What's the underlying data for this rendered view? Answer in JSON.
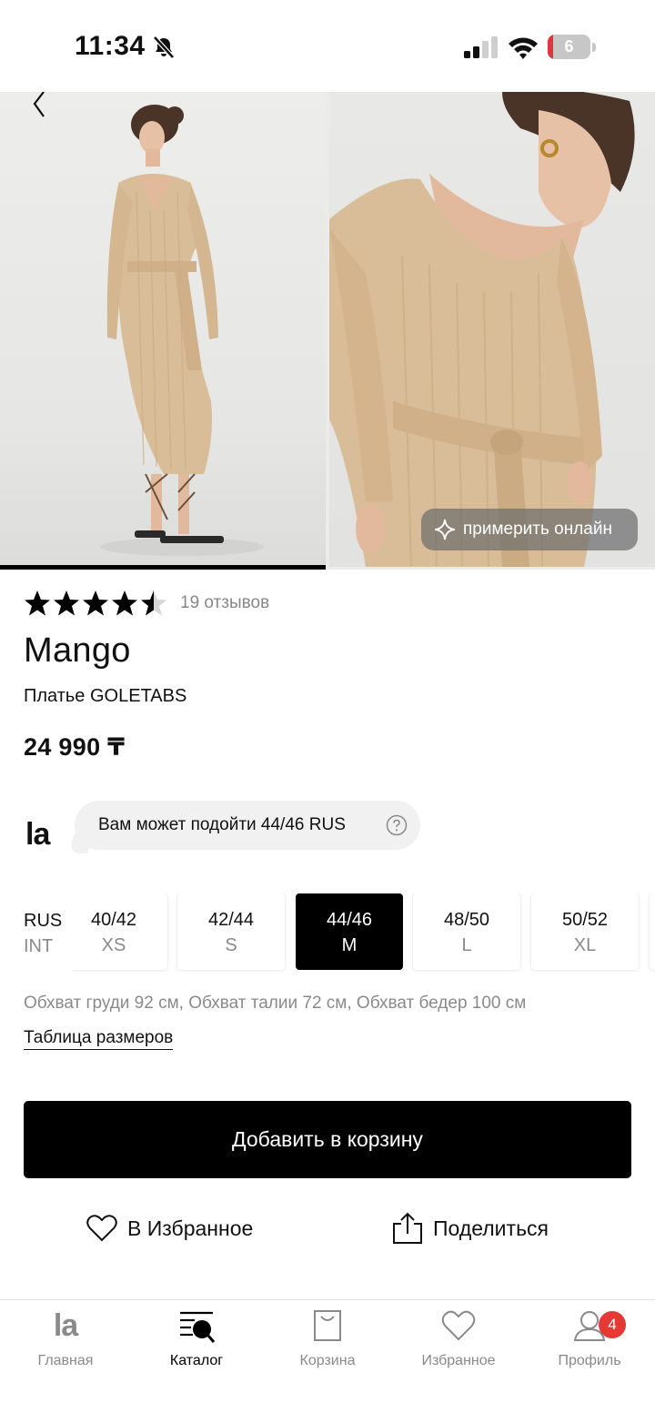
{
  "status_bar": {
    "time": "11:34",
    "battery": "6",
    "battery_level": 0.06
  },
  "gallery": {
    "tryon_label": "примерить онлайн",
    "active_index": 0
  },
  "product": {
    "rating": 4.5,
    "reviews": "19 отзывов",
    "brand": "Mango",
    "name": "Платье GOLETABS",
    "price": "24 990 ₸"
  },
  "fit": {
    "logo": "la",
    "message": "Вам может подойти 44/46 RUS"
  },
  "sizes": {
    "system_primary": "RUS",
    "system_secondary": "INT",
    "options": [
      {
        "rus": "40/42",
        "int": "XS",
        "selected": false
      },
      {
        "rus": "42/44",
        "int": "S",
        "selected": false
      },
      {
        "rus": "44/46",
        "int": "M",
        "selected": true
      },
      {
        "rus": "48/50",
        "int": "L",
        "selected": false
      },
      {
        "rus": "50/52",
        "int": "XL",
        "selected": false
      }
    ],
    "measurements": "Обхват груди 92 см, Обхват талии 72 см, Обхват бедер 100 см",
    "size_table_link": "Таблица размеров"
  },
  "actions": {
    "add_to_cart": "Добавить в корзину",
    "favorite": "В Избранное",
    "share": "Поделиться"
  },
  "tab_bar": {
    "home": "Главная",
    "catalog": "Каталог",
    "cart": "Корзина",
    "favorites": "Избранное",
    "profile": "Профиль",
    "profile_badge": "4",
    "home_logo": "la"
  },
  "colors": {
    "accent": "#000000",
    "badge": "#E53935",
    "muted_text": "#8A8A8A",
    "dress": "#D9BD98"
  }
}
